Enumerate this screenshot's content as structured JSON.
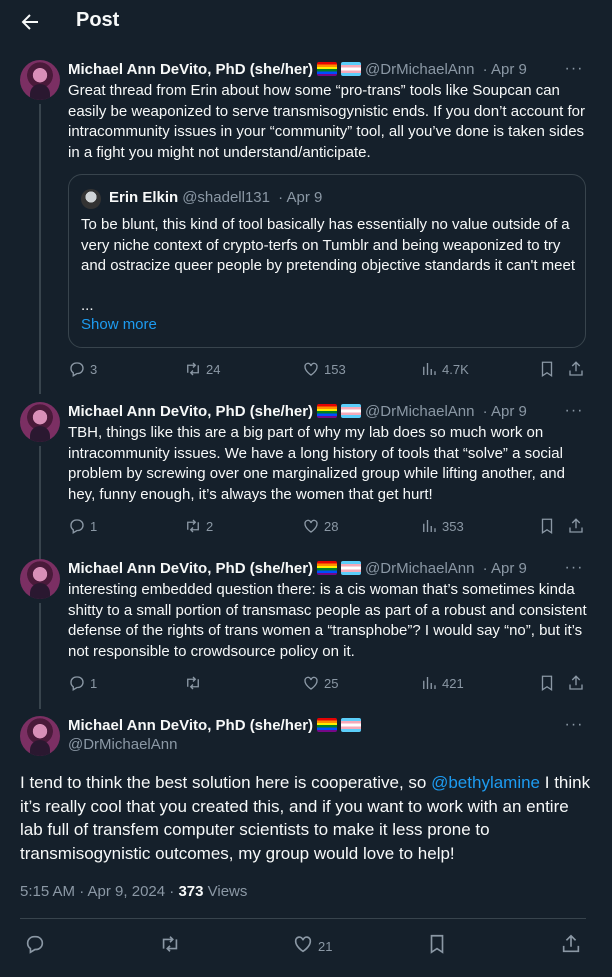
{
  "header": {
    "title": "Post"
  },
  "tweets": [
    {
      "name": "Michael Ann DeVito, PhD (she/her)",
      "handle": "@DrMichaelAnn",
      "date": "Apr 9",
      "text": "Great thread from Erin about how some “pro-trans” tools like Soupcan can easily be weaponized to serve transmisogynistic ends. If you don’t account for intracommunity issues in your “community” tool, all you’ve done is taken sides in a fight you might not understand/anticipate.",
      "quote": {
        "name": "Erin Elkin",
        "handle": "@shadell131",
        "date": "Apr 9",
        "text": "To be blunt, this kind of tool basically has essentially no value outside of a very niche context of crypto-terfs on Tumblr and being weaponized to try and ostracize queer people by pretending objective standards it can't meet",
        "ellipsis": "...",
        "show_more": "Show more"
      },
      "replies": "3",
      "reposts": "24",
      "likes": "153",
      "views": "4.7K"
    },
    {
      "name": "Michael Ann DeVito, PhD (she/her)",
      "handle": "@DrMichaelAnn",
      "date": "Apr 9",
      "text": "TBH, things like this are a big part of why my lab does so much work on intracommunity issues. We have a long history of tools that “solve” a social problem by screwing over one marginalized group while lifting another, and hey, funny enough, it’s always the women that get hurt!",
      "replies": "1",
      "reposts": "2",
      "likes": "28",
      "views": "353"
    },
    {
      "name": "Michael Ann DeVito, PhD (she/her)",
      "handle": "@DrMichaelAnn",
      "date": "Apr 9",
      "text": "interesting embedded question there: is a cis woman that’s sometimes kinda shitty to a small portion of transmasc people as part of a robust and consistent defense of the rights of trans women a “transphobe”? I would say “no”, but it’s not responsible to crowdsource policy on it.",
      "replies": "1",
      "reposts": "",
      "likes": "25",
      "views": "421"
    }
  ],
  "main": {
    "name": "Michael Ann DeVito, PhD (she/her)",
    "handle": "@DrMichaelAnn",
    "text_before": "I tend to think the best solution here is cooperative, so ",
    "mention": "@bethylamine",
    "text_after": " I think it’s really cool that you created this, and if you want to work with an entire lab full of transfem computer scientists to make it less prone to transmisogynistic outcomes, my group would love to help!",
    "time": "5:15 AM · Apr 9, 2024 · ",
    "views_count": "373",
    "views_label": " Views",
    "likes": "21"
  },
  "colors": {
    "background": "#15202b",
    "text": "#f7f9f9",
    "secondary": "#8b98a5",
    "accent": "#1d9bf0",
    "border": "#38444d"
  },
  "icons": [
    "back-arrow-icon",
    "more-icon",
    "reply-icon",
    "repost-icon",
    "like-icon",
    "views-icon",
    "bookmark-icon",
    "share-icon",
    "pride-flag-icon",
    "trans-flag-icon"
  ]
}
